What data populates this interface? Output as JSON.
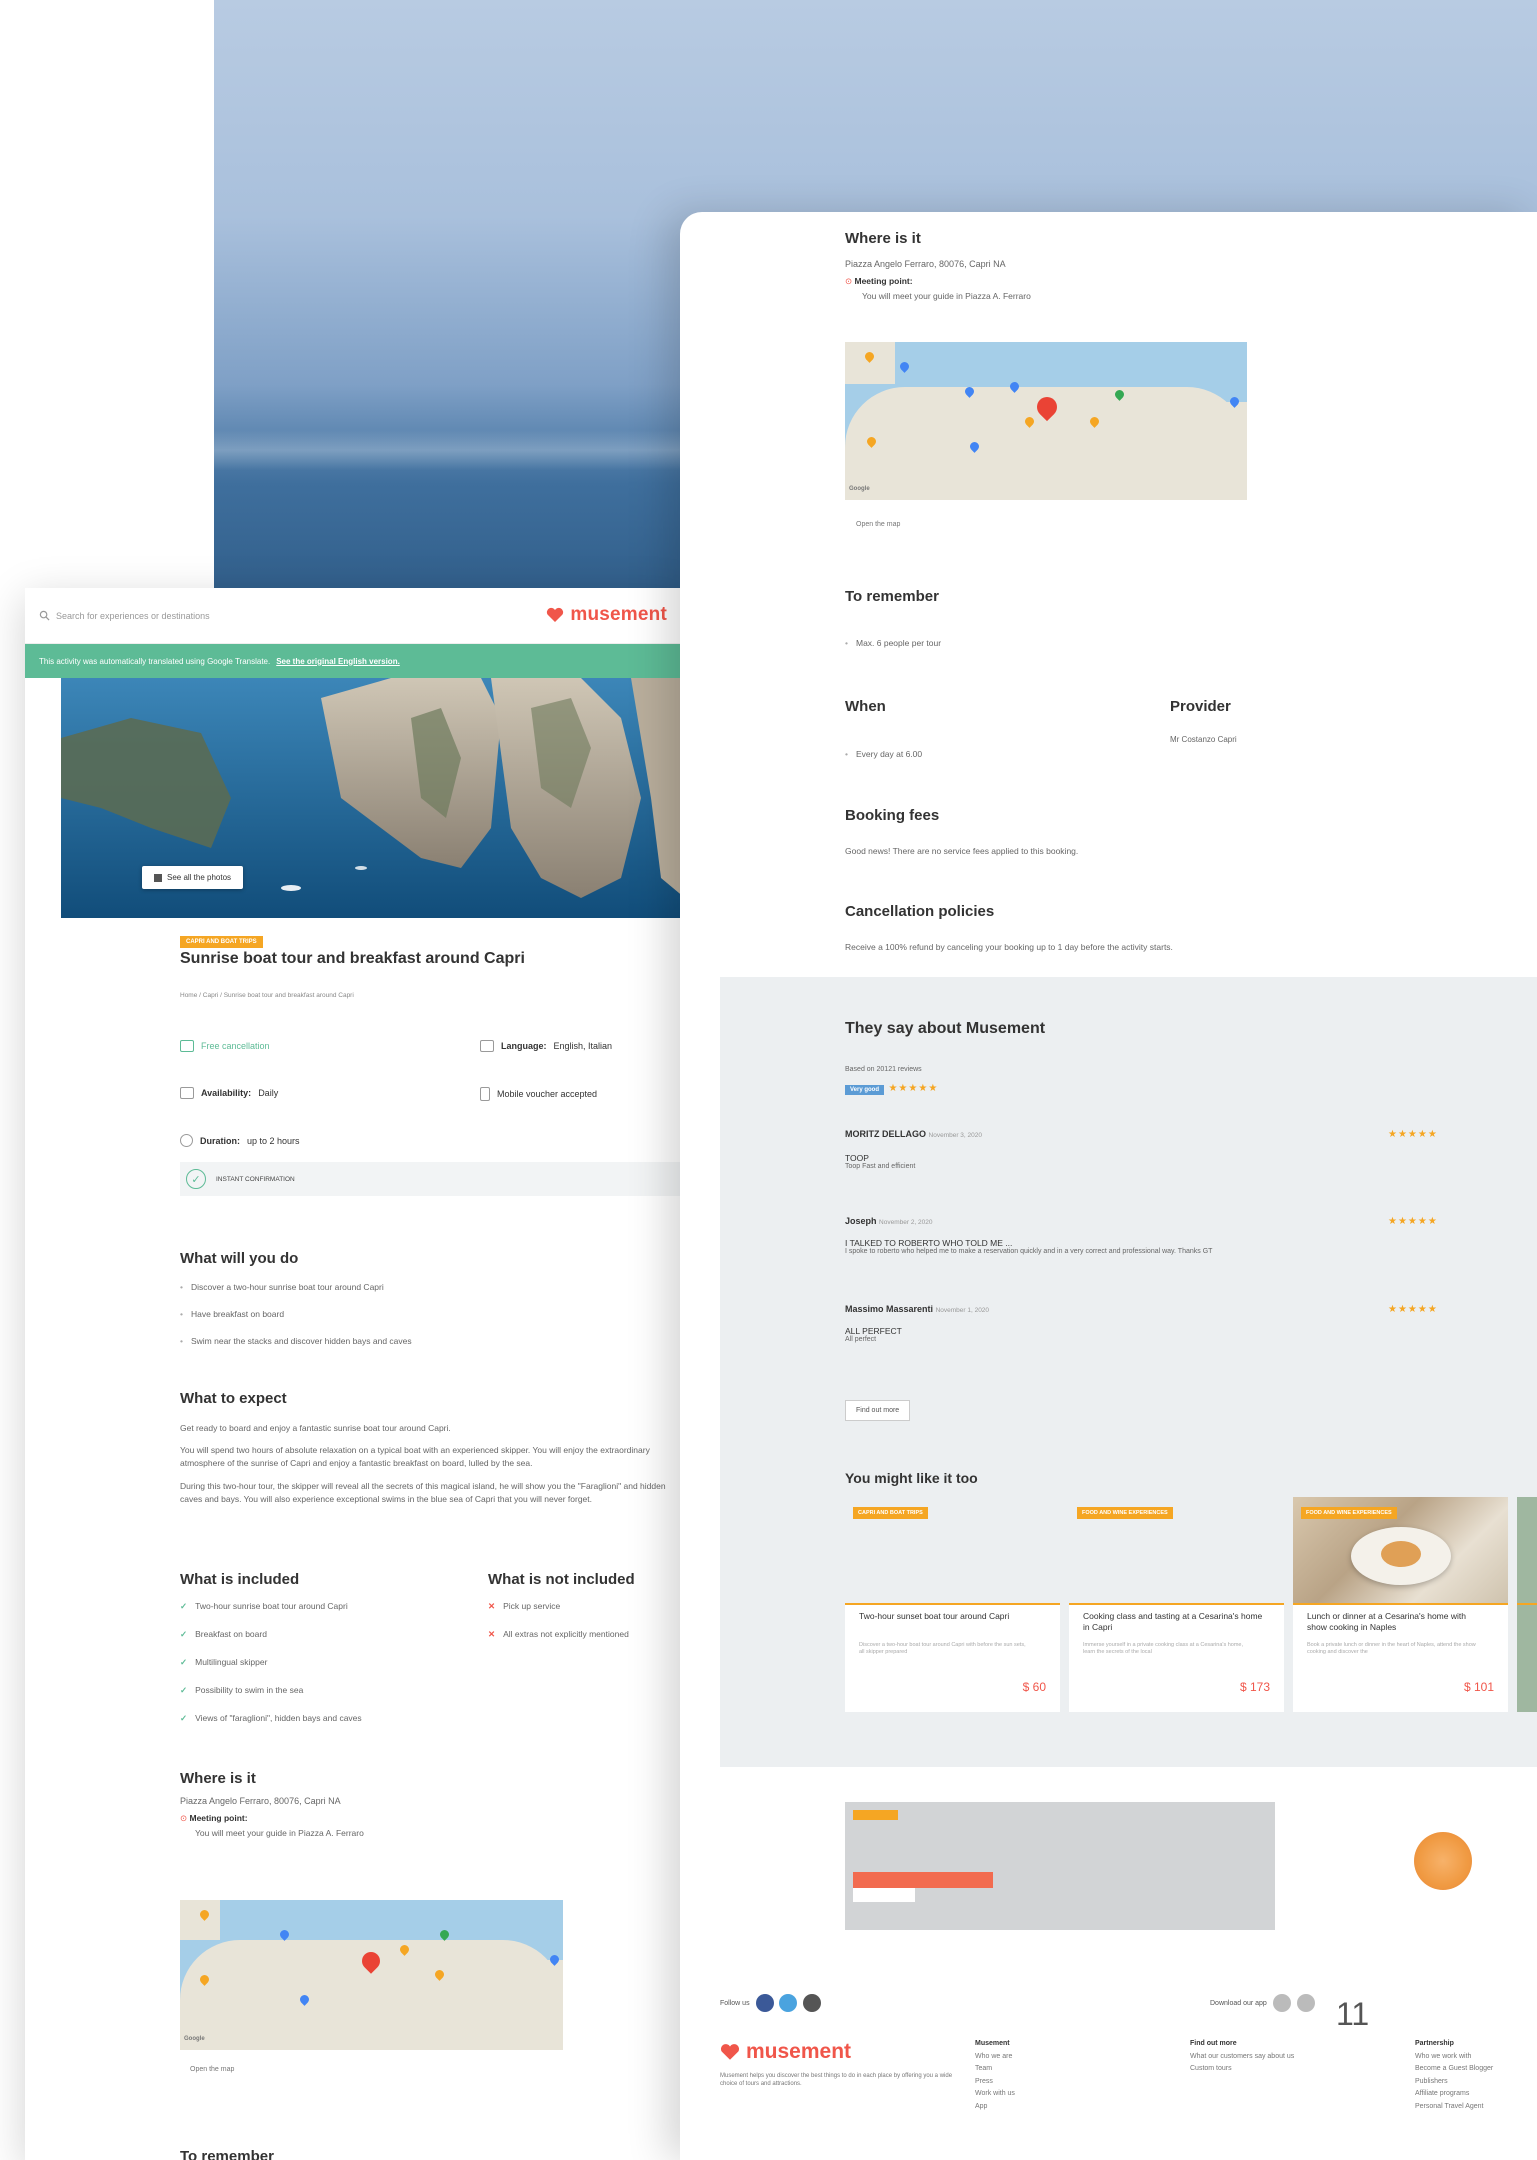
{
  "left": {
    "search_placeholder": "Search for experiences or destinations",
    "logo": "musement",
    "banner_text": "This activity was automatically translated using Google Translate.",
    "banner_link": "See the original English version.",
    "photo_button": "See all the photos",
    "tag": "Capri and boat trips",
    "title": "Sunrise boat tour and breakfast around Capri",
    "breadcrumb": "Home / Capri / Sunrise boat tour and breakfast around Capri",
    "features": {
      "free_cancellation": "Free cancellation",
      "language_label": "Language:",
      "language_value": "English, Italian",
      "availability_label": "Availability:",
      "availability_value": "Daily",
      "mobile_voucher": "Mobile voucher accepted",
      "duration_label": "Duration:",
      "duration_value": "up to 2 hours",
      "instant_confirmation": "Instant confirmation"
    },
    "what_will_you_do": {
      "heading": "What will you do",
      "items": [
        "Discover a two-hour sunrise boat tour around Capri",
        "Have breakfast on board",
        "Swim near the stacks and discover hidden bays and caves"
      ]
    },
    "what_to_expect": {
      "heading": "What to expect",
      "p1": "Get ready to board and enjoy a fantastic sunrise boat tour around Capri.",
      "p2": "You will spend two hours of absolute relaxation on a typical boat with an experienced skipper. You will enjoy the extraordinary atmosphere of the sunrise of Capri and enjoy a fantastic breakfast on board, lulled by the sea.",
      "p3": "During this two-hour tour, the skipper will reveal all the secrets of this magical island, he will show you the \"Faraglioni\" and hidden caves and bays. You will also experience exceptional swims in the blue sea of Capri that you will never forget."
    },
    "included": {
      "heading": "What is included",
      "items": [
        "Two-hour sunrise boat tour around Capri",
        "Breakfast on board",
        "Multilingual skipper",
        "Possibility to swim in the sea",
        "Views of \"faraglioni\", hidden bays and caves"
      ]
    },
    "not_included": {
      "heading": "What is not included",
      "items": [
        "Pick up service",
        "All extras not explicitly mentioned"
      ]
    },
    "where": {
      "heading": "Where is it",
      "address": "Piazza Angelo Ferraro, 80076, Capri NA",
      "meeting_label": "Meeting point:",
      "meeting_text": "You will meet your guide in Piazza A. Ferraro",
      "open_map": "Open the map",
      "google": "Google"
    },
    "to_remember_heading": "To remember"
  },
  "right": {
    "where": {
      "heading": "Where is it",
      "address": "Piazza Angelo Ferraro, 80076, Capri NA",
      "meeting_label": "Meeting point:",
      "meeting_text": "You will meet your guide in Piazza A. Ferraro",
      "open_map": "Open the map",
      "google": "Google"
    },
    "to_remember": {
      "heading": "To remember",
      "item": "Max. 6 people per tour"
    },
    "when": {
      "heading": "When",
      "item": "Every day at 6.00"
    },
    "provider": {
      "heading": "Provider",
      "value": "Mr Costanzo Capri"
    },
    "booking_fees": {
      "heading": "Booking fees",
      "text": "Good news! There are no service fees applied to this booking."
    },
    "cancellation": {
      "heading": "Cancellation policies",
      "text": "Receive a 100% refund by canceling your booking up to 1 day before the activity starts."
    },
    "reviews": {
      "heading": "They say about Musement",
      "based_on": "Based on 20121 reviews",
      "badge": "Very good",
      "items": [
        {
          "name": "MORITZ DELLAGO",
          "date": "November 3, 2020",
          "title": "TOOP",
          "text": "Toop Fast and efficient"
        },
        {
          "name": "Joseph",
          "date": "November 2, 2020",
          "title": "I TALKED TO ROBERTO WHO TOLD ME ...",
          "text": "I spoke to roberto who helped me to make a reservation quickly and in a very correct and professional way. Thanks GT"
        },
        {
          "name": "Massimo Massarenti",
          "date": "November 1, 2020",
          "title": "ALL PERFECT",
          "text": "All perfect"
        }
      ],
      "find_out_more": "Find out more"
    },
    "might_like": {
      "heading": "You might like it too",
      "cards": [
        {
          "tag": "Capri and boat trips",
          "title": "Two-hour sunset boat tour around Capri",
          "desc": "Discover a two-hour boat tour around Capri with before the sun sets, all skipper prepared",
          "price": "$ 60"
        },
        {
          "tag": "Food and wine experiences",
          "title": "Cooking class and tasting at a Cesarina's home in Capri",
          "desc": "Immerse yourself in a private cooking class at a Cesarina's home, learn the secrets of the local",
          "price": "$ 173"
        },
        {
          "tag": "Food and wine experiences",
          "title": "Lunch or dinner at a Cesarina's home with show cooking in Naples",
          "desc": "Book a private lunch or dinner in the heart of Naples, attend the show cooking and discover the",
          "price": "$ 101"
        }
      ]
    },
    "footer": {
      "follow_us": "Follow us",
      "download_app": "Download our app",
      "logo": "musement",
      "about": "Musement helps you discover the best things to do in each place by offering you a wide choice of tours and attractions.",
      "col1": {
        "heading": "Musement",
        "items": [
          "Who we are",
          "Team",
          "Press",
          "Work with us",
          "App"
        ]
      },
      "col2": {
        "heading": "Find out more",
        "items": [
          "What our customers say about us",
          "Custom tours"
        ]
      },
      "col3": {
        "heading": "Partnership",
        "items": [
          "Who we work with",
          "Become a Guest Blogger",
          "Publishers",
          "Affiliate programs",
          "Personal Travel Agent"
        ]
      }
    }
  },
  "page_number": "11",
  "colors": {
    "accent": "#f0564a",
    "green": "#5dbb96",
    "tag": "#f5a623",
    "review_badge": "#5b9bd5"
  }
}
